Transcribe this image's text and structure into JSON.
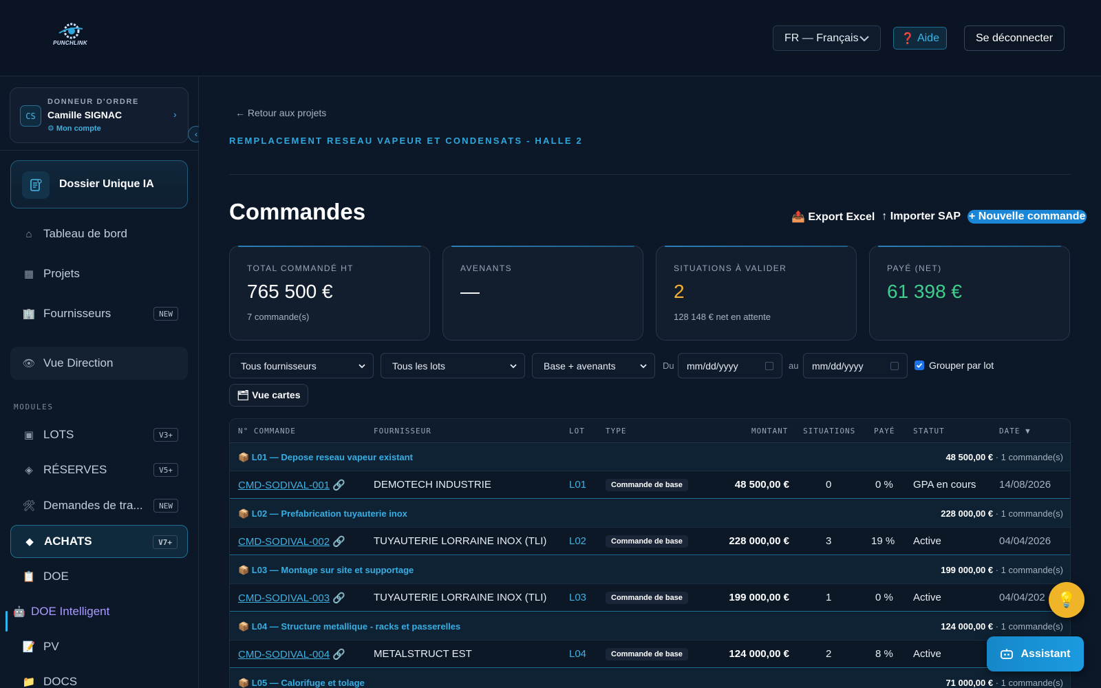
{
  "header": {
    "logo_text": "PUNCHLINK",
    "language": "FR — Français",
    "help": "Aide",
    "logout": "Se déconnecter"
  },
  "account": {
    "initials": "CS",
    "role": "DONNEUR D'ORDRE",
    "name": "Camille SIGNAC",
    "link": "⚙ Mon compte"
  },
  "sidebar": {
    "dossier": "Dossier Unique IA",
    "nav": [
      {
        "label": "Tableau de bord",
        "icon": "home-icon",
        "glyph": "⌂"
      },
      {
        "label": "Projets",
        "icon": "grid-icon",
        "glyph": "▦"
      },
      {
        "label": "Fournisseurs",
        "icon": "building-icon",
        "glyph": "🏢",
        "badge": "NEW"
      },
      {
        "label": "Vue Direction",
        "icon": "eye-icon",
        "glyph": "👁"
      }
    ],
    "modules_label": "MODULES",
    "modules": [
      {
        "label": "LOTS",
        "icon": "square-icon",
        "glyph": "▣",
        "badge": "V3+"
      },
      {
        "label": "RÉSERVES",
        "icon": "diamond-outline-icon",
        "glyph": "◈",
        "badge": "V5+"
      },
      {
        "label": "Demandes de tra...",
        "icon": "tools-icon",
        "glyph": "🛠",
        "badge": "NEW"
      },
      {
        "label": "ACHATS",
        "icon": "diamond-icon",
        "glyph": "◆",
        "badge": "V7+"
      },
      {
        "label": "DOE",
        "icon": "clipboard-icon",
        "glyph": "📋"
      },
      {
        "label": "DOE Intelligent",
        "icon": "robot-icon",
        "glyph": "🤖"
      },
      {
        "label": "PV",
        "icon": "memo-icon",
        "glyph": "📝"
      },
      {
        "label": "DOCS",
        "icon": "folder-icon",
        "glyph": "📁"
      }
    ]
  },
  "main": {
    "back": "← Retour aux projets",
    "project": "REMPLACEMENT RESEAU VAPEUR ET CONDENSATS - HALLE 2",
    "title": "Commandes",
    "actions": {
      "export": "📤 Export Excel",
      "import": "↑ Importer SAP",
      "new": "+ Nouvelle commande"
    },
    "kpis": [
      {
        "label": "TOTAL COMMANDÉ HT",
        "value": "765 500 €",
        "sub": "7 commande(s)",
        "color": "#ffffff"
      },
      {
        "label": "AVENANTS",
        "value": "—",
        "sub": "",
        "color": "#ffffff"
      },
      {
        "label": "SITUATIONS À VALIDER",
        "value": "2",
        "sub": "128 148 € net en attente",
        "color": "#f2b233"
      },
      {
        "label": "PAYÉ (NET)",
        "value": "61 398 €",
        "sub": "",
        "color": "#3ecf8e"
      }
    ],
    "filters": {
      "supplier": "Tous fournisseurs",
      "lots": "Tous les lots",
      "scope": "Base + avenants",
      "from_label": "Du",
      "from_placeholder": "mm/dd/yyyy",
      "to_label": "au",
      "to_placeholder": "mm/dd/yyyy",
      "group_label": "Grouper par lot",
      "group_checked": true,
      "cards_view": "🗂 Vue cartes"
    },
    "table": {
      "columns": [
        "N° COMMANDE",
        "FOURNISSEUR",
        "LOT",
        "TYPE",
        "MONTANT",
        "SITUATIONS",
        "PAYÉ",
        "STATUT",
        "DATE ▼"
      ],
      "groups": [
        {
          "title": "📦 L01 — Depose reseau vapeur existant",
          "total": "48 500,00 €",
          "count": " · 1 commande(s)",
          "row": {
            "cmd": "CMD-SODIVAL-001",
            "link": "🔗",
            "supplier": "DEMOTECH INDUSTRIE",
            "lot": "L01",
            "type": "Commande de base",
            "amount": "48 500,00 €",
            "situations": "0",
            "paid": "0 %",
            "status": "GPA en cours",
            "date": "14/08/2026"
          }
        },
        {
          "title": "📦 L02 — Prefabrication tuyauterie inox",
          "total": "228 000,00 €",
          "count": " · 1 commande(s)",
          "row": {
            "cmd": "CMD-SODIVAL-002",
            "link": "🔗",
            "supplier": "TUYAUTERIE LORRAINE INOX (TLI)",
            "lot": "L02",
            "type": "Commande de base",
            "amount": "228 000,00 €",
            "situations": "3",
            "paid": "19 %",
            "status": "Active",
            "date": "04/04/2026"
          }
        },
        {
          "title": "📦 L03 — Montage sur site et supportage",
          "total": "199 000,00 €",
          "count": " · 1 commande(s)",
          "row": {
            "cmd": "CMD-SODIVAL-003",
            "link": "🔗",
            "supplier": "TUYAUTERIE LORRAINE INOX (TLI)",
            "lot": "L03",
            "type": "Commande de base",
            "amount": "199 000,00 €",
            "situations": "1",
            "paid": "0 %",
            "status": "Active",
            "date": "04/04/202"
          }
        },
        {
          "title": "📦 L04 — Structure metallique - racks et passerelles",
          "total": "124 000,00 €",
          "count": " · 1 commande(s)",
          "row": {
            "cmd": "CMD-SODIVAL-004",
            "link": "🔗",
            "supplier": "METALSTRUCT EST",
            "lot": "L04",
            "type": "Commande de base",
            "amount": "124 000,00 €",
            "situations": "2",
            "paid": "8 %",
            "status": "Active",
            "date": ""
          }
        },
        {
          "title": "📦 L05 — Calorifuge et tolage",
          "total": "71 000,00 €",
          "count": " · 1 commande(s)",
          "row": null
        }
      ]
    }
  },
  "floating": {
    "assistant": "Assistant",
    "tip_icon": "💡"
  }
}
